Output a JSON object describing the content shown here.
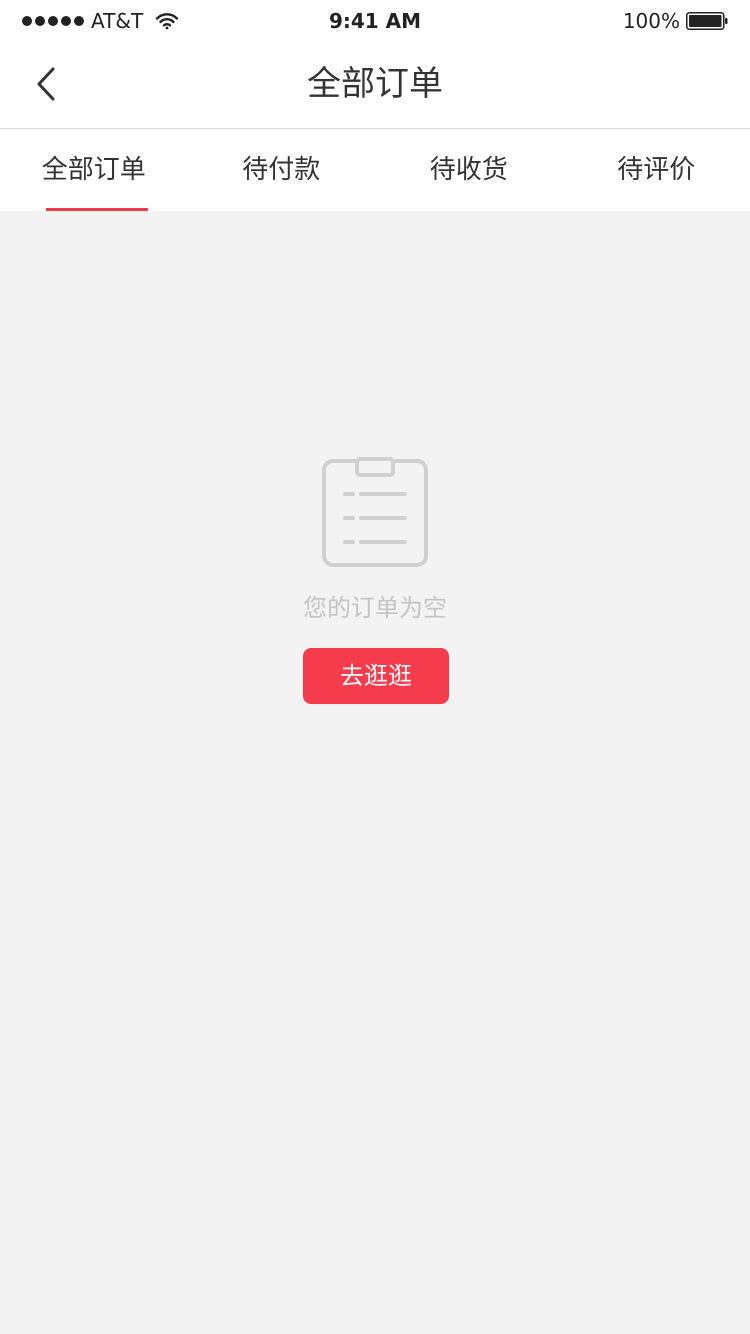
{
  "status_bar": {
    "carrier": "AT&T",
    "time": "9:41 AM",
    "battery": "100%"
  },
  "nav": {
    "title": "全部订单",
    "back_icon": "chevron-left-icon"
  },
  "tabs": [
    {
      "label": "全部订单",
      "active": true
    },
    {
      "label": "待付款",
      "active": false
    },
    {
      "label": "待收货",
      "active": false
    },
    {
      "label": "待评价",
      "active": false
    }
  ],
  "empty_state": {
    "icon": "clipboard-list-icon",
    "message": "您的订单为空",
    "button_label": "去逛逛"
  },
  "colors": {
    "accent": "#f53c4c",
    "tab_indicator": "#f03c4a",
    "background": "#f3f3f3",
    "empty_text": "#c4c4c4",
    "icon_gray": "#d0d0d0"
  }
}
